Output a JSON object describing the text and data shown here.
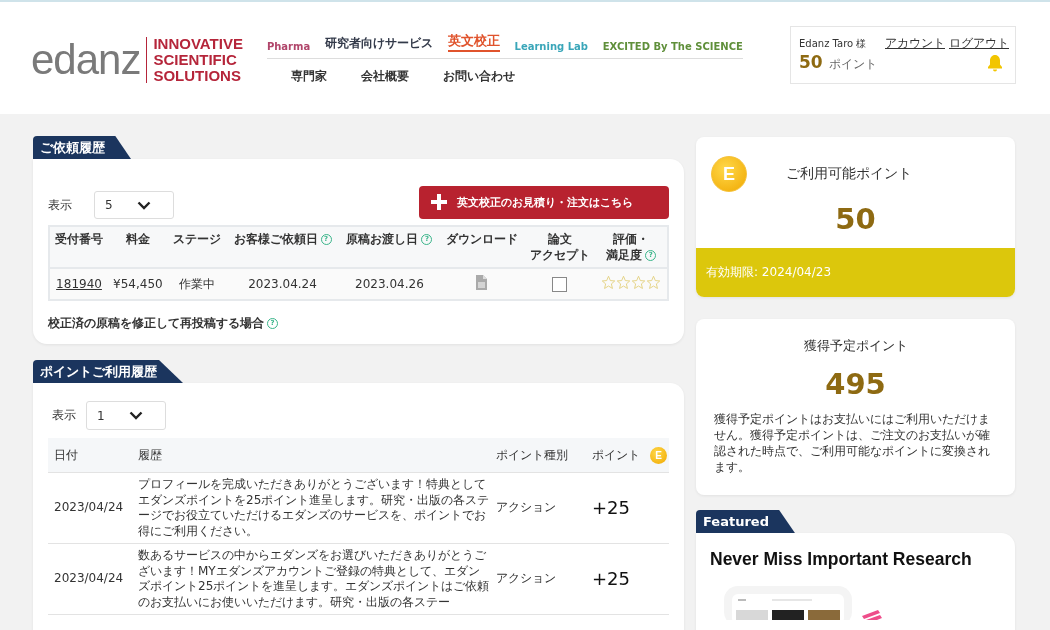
{
  "header": {
    "logo_wordmark": "edanz",
    "logo_tagline": [
      "INNOVATIVE",
      "SCIENTIFIC",
      "SOLUTIONS"
    ],
    "nav_primary": [
      {
        "label": "Pharma",
        "color": "#b0456a",
        "selected": false
      },
      {
        "label": "研究者向けサービス",
        "color": "#333a4a",
        "selected": false
      },
      {
        "label": "英文校正",
        "color": "#e0532c",
        "selected": true
      },
      {
        "label": "Learning Lab",
        "color": "#3aa6b9",
        "selected": false
      },
      {
        "label": "EXCITED By The SCIENCE",
        "color": "#5f8f3a",
        "selected": false
      }
    ],
    "nav_secondary": [
      "専門家",
      "会社概要",
      "お問い合わせ"
    ],
    "user": {
      "name": "Edanz Taro 様",
      "links": [
        "アカウント",
        "ログアウト"
      ],
      "points": "50",
      "points_unit": "ポイント"
    }
  },
  "orders": {
    "title": "ご依頼履歴",
    "show_label": "表示",
    "show_value": "5",
    "order_button": "英文校正のお見積り・注文はこちら",
    "columns": [
      {
        "lines": [
          "受付番号"
        ]
      },
      {
        "lines": [
          "料金"
        ]
      },
      {
        "lines": [
          "ステージ"
        ]
      },
      {
        "lines": [
          "お客様ご依頼日"
        ],
        "help": "?"
      },
      {
        "lines": [
          "原稿お渡し日"
        ],
        "help": "?"
      },
      {
        "lines": [
          "ダウンロード"
        ]
      },
      {
        "lines": [
          "論文",
          "アクセプト"
        ]
      },
      {
        "lines": [
          "評価・",
          "満足度"
        ],
        "help": "?"
      }
    ],
    "rows": [
      {
        "number": "181940",
        "fee": "¥54,450",
        "stage": "作業中",
        "requested": "2023.04.24",
        "delivered": "2023.04.26",
        "accepted": false,
        "stars": 0
      }
    ],
    "footnote": "校正済の原稿を修正して再投稿する場合",
    "footnote_help": "?"
  },
  "points_history": {
    "title": "ポイントご利用履歴",
    "show_label": "表示",
    "show_value": "1",
    "columns": [
      "日付",
      "履歴",
      "ポイント種別",
      "ポイント"
    ],
    "points_coin": "E",
    "rows": [
      {
        "date": "2023/04/24",
        "text": "プロフィールを完成いただきありがとうございます！特典としてエダンズポイントを25ポイント進呈します。研究・出版の各ステージでお役立ていただけるエダンズのサービスを、ポイントでお得にご利用ください。",
        "type": "アクション",
        "points": "+25"
      },
      {
        "date": "2023/04/24",
        "text": "数あるサービスの中からエダンズをお選びいただきありがとうございます！MYエダンズアカウントご登録の特典として、エダンズポイント25ポイントを進呈します。エダンズポイントはご依頼のお支払いにお使いいただけます。研究・出版の各ステー",
        "type": "アクション",
        "points": "+25"
      }
    ]
  },
  "available": {
    "coin": "E",
    "title": "ご利用可能ポイント",
    "value": "50",
    "expiry": "有効期限: 2024/04/23"
  },
  "pending": {
    "title": "獲得予定ポイント",
    "value": "495",
    "note": "獲得予定ポイントはお支払いにはご利用いただけません。獲得予定ポイントは、ご注文のお支払いが確認された時点で、ご利用可能なポイントに変換されます。"
  },
  "featured": {
    "tab": "Featured",
    "title": "Never Miss Important Research"
  }
}
